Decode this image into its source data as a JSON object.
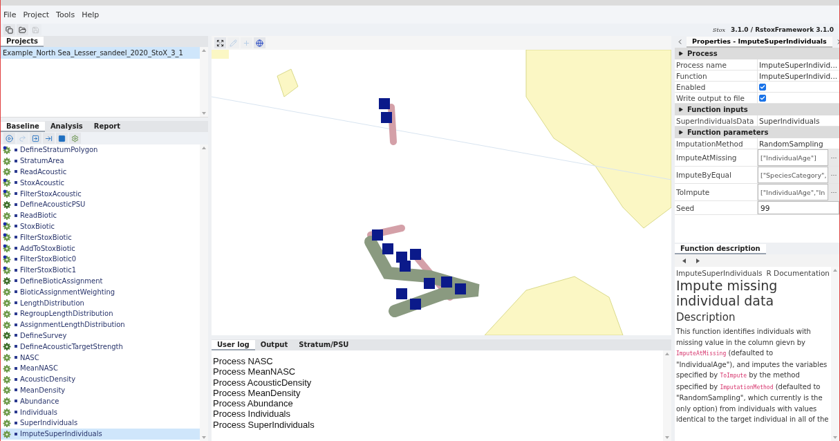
{
  "menu": [
    "File",
    "Project",
    "Tools",
    "Help"
  ],
  "main_toolbar": [
    {
      "kind": "window",
      "disabled": false
    },
    {
      "kind": "folder",
      "disabled": false
    },
    {
      "kind": "save",
      "disabled": true
    }
  ],
  "version": {
    "logo_text": "Stox",
    "text": "3.1.0 / RstoxFramework 3.1.0"
  },
  "projects": {
    "tabs": [
      {
        "label": "Projects",
        "selected": true
      }
    ],
    "items": [
      {
        "label": "Example_North Sea_Lesser_sandeel_2020_StoX_3_1",
        "selected": true
      }
    ]
  },
  "models": {
    "tabs": [
      {
        "label": "Baseline",
        "selected": true
      },
      {
        "label": "Analysis",
        "selected": false
      },
      {
        "label": "Report",
        "selected": false
      }
    ],
    "toolbar": [
      {
        "kind": "play",
        "disabled": false
      },
      {
        "kind": "redo",
        "disabled": true
      },
      {
        "kind": "run-from",
        "disabled": false
      },
      {
        "kind": "run-to",
        "disabled": false
      },
      {
        "kind": "stop",
        "disabled": false
      },
      {
        "kind": "add",
        "disabled": false
      }
    ],
    "processes": [
      {
        "label": "DefineStratumPolygon",
        "kind": "data",
        "selected": false
      },
      {
        "label": "StratumArea",
        "kind": "plain",
        "selected": false
      },
      {
        "label": "ReadAcoustic",
        "kind": "plain",
        "selected": false
      },
      {
        "label": "StoxAcoustic",
        "kind": "data",
        "selected": false
      },
      {
        "label": "FilterStoxAcoustic",
        "kind": "data",
        "selected": false
      },
      {
        "label": "DefineAcousticPSU",
        "kind": "define",
        "selected": false
      },
      {
        "label": "ReadBiotic",
        "kind": "plain",
        "selected": false
      },
      {
        "label": "StoxBiotic",
        "kind": "data",
        "selected": false
      },
      {
        "label": "FilterStoxBiotic",
        "kind": "data",
        "selected": false
      },
      {
        "label": "AddToStoxBiotic",
        "kind": "data",
        "selected": false
      },
      {
        "label": "FilterStoxBiotic0",
        "kind": "data",
        "selected": false
      },
      {
        "label": "FilterStoxBiotic1",
        "kind": "data",
        "selected": false
      },
      {
        "label": "DefineBioticAssignment",
        "kind": "define",
        "selected": false
      },
      {
        "label": "BioticAssignmentWeighting",
        "kind": "plain",
        "selected": false
      },
      {
        "label": "LengthDistribution",
        "kind": "plain",
        "selected": false
      },
      {
        "label": "RegroupLengthDistribution",
        "kind": "plain",
        "selected": false
      },
      {
        "label": "AssignmentLengthDistribution",
        "kind": "plain",
        "selected": false
      },
      {
        "label": "DefineSurvey",
        "kind": "define",
        "selected": false
      },
      {
        "label": "DefineAcousticTargetStrength",
        "kind": "define",
        "selected": false
      },
      {
        "label": "NASC",
        "kind": "plain",
        "selected": false
      },
      {
        "label": "MeanNASC",
        "kind": "plain",
        "selected": false
      },
      {
        "label": "AcousticDensity",
        "kind": "plain",
        "selected": false
      },
      {
        "label": "MeanDensity",
        "kind": "plain",
        "selected": false
      },
      {
        "label": "Abundance",
        "kind": "plain",
        "selected": false
      },
      {
        "label": "Individuals",
        "kind": "plain",
        "selected": false
      },
      {
        "label": "SuperIndividuals",
        "kind": "plain",
        "selected": false
      },
      {
        "label": "ImputeSuperIndividuals",
        "kind": "plain",
        "selected": true
      }
    ]
  },
  "map": {
    "toolbar": [
      {
        "kind": "extent",
        "disabled": false
      },
      {
        "kind": "pencil",
        "disabled": true
      },
      {
        "kind": "plus",
        "disabled": true
      },
      {
        "kind": "globe",
        "disabled": false
      }
    ],
    "kind": "picture"
  },
  "log": {
    "tabs": [
      {
        "label": "User log",
        "selected": true
      },
      {
        "label": "Output",
        "selected": false
      },
      {
        "label": "Stratum/PSU",
        "selected": false
      }
    ],
    "lines": [
      "Process NASC",
      "Process MeanNASC",
      "Process AcousticDensity",
      "Process MeanDensity",
      "Process Abundance",
      "Process Individuals",
      "Process SuperIndividuals"
    ]
  },
  "properties": {
    "tabs": [
      {
        "label": "Properties - ImputeSuperIndividuals",
        "selected": true
      }
    ],
    "rows": [
      {
        "kind": "section",
        "label": "Process"
      },
      {
        "kind": "text",
        "name": "Process name",
        "value": "ImputeSuperIndivid..."
      },
      {
        "kind": "text",
        "name": "Function",
        "value": "ImputeSuperIndivid..."
      },
      {
        "kind": "check",
        "name": "Enabled",
        "checked": true
      },
      {
        "kind": "check",
        "name": "Write output to file",
        "checked": true
      },
      {
        "kind": "section",
        "label": "Function inputs"
      },
      {
        "kind": "text",
        "name": "SuperIndividualsData",
        "value": "SuperIndividuals"
      },
      {
        "kind": "section",
        "label": "Function parameters"
      },
      {
        "kind": "text",
        "name": "ImputationMethod",
        "value": "RandomSampling"
      },
      {
        "kind": "editor",
        "name": "ImputeAtMissing",
        "value": "[\"IndividualAge\"]",
        "button": "···"
      },
      {
        "kind": "editor",
        "name": "ImputeByEqual",
        "value": "[\"SpeciesCategory\",",
        "button": "···"
      },
      {
        "kind": "editor",
        "name": "ToImpute",
        "value": "[\"IndividualAge\",\"In",
        "button": "···"
      },
      {
        "kind": "input",
        "name": "Seed",
        "value": "99"
      }
    ]
  },
  "description": {
    "tabs": [
      {
        "label": "Function description",
        "selected": true
      }
    ],
    "doc_name": "ImputeSuperIndividuals",
    "doc_source": "R Documentation",
    "title": "Impute missing individual data",
    "heading": "Description",
    "paragraph": [
      {
        "kind": "text",
        "text": "This function identifies individuals with missing value in the column gievn by "
      },
      {
        "kind": "code",
        "text": "ImputeAtMissing"
      },
      {
        "kind": "text",
        "text": " (defaulted to \"IndividualAge\"), and imputes the variables specified by "
      },
      {
        "kind": "code",
        "text": "ToImpute"
      },
      {
        "kind": "text",
        "text": " by the method specified by "
      },
      {
        "kind": "code",
        "text": "ImputationMethod"
      },
      {
        "kind": "text",
        "text": " (defaulted to \"RandomSampling\", which currently is the only option) from individuals with values identical to the target individual in all of the"
      }
    ]
  }
}
